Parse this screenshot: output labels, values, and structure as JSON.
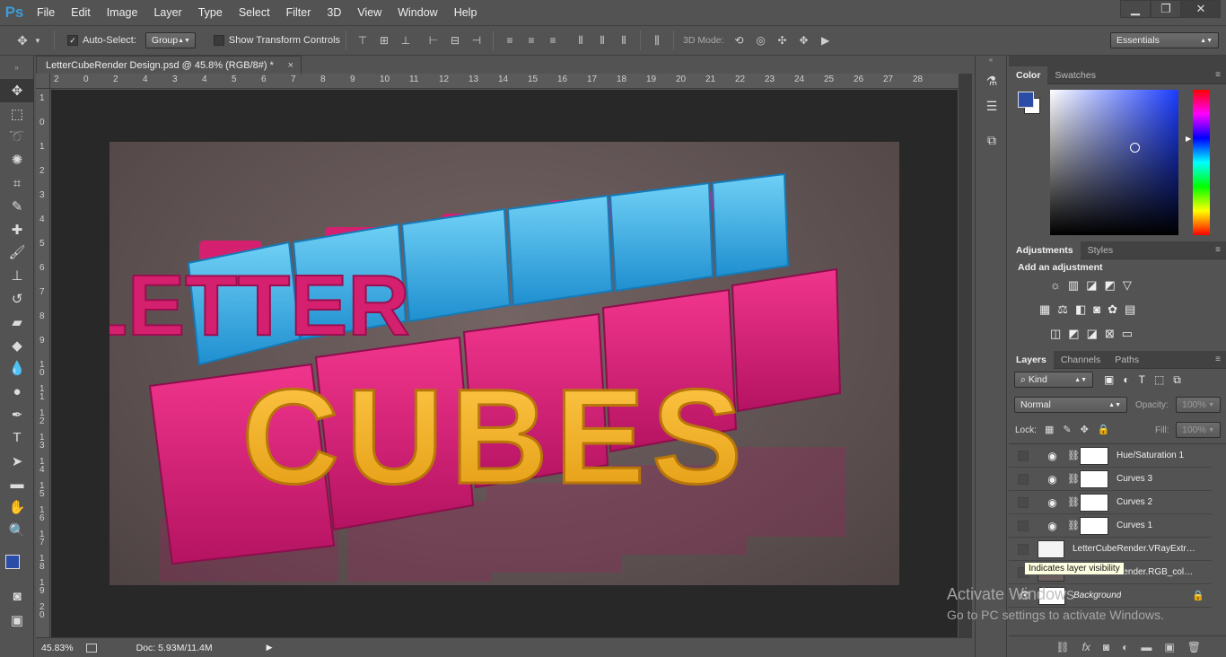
{
  "app": {
    "logo": "Ps"
  },
  "menu": [
    "File",
    "Edit",
    "Image",
    "Layer",
    "Type",
    "Select",
    "Filter",
    "3D",
    "View",
    "Window",
    "Help"
  ],
  "window_controls": {
    "minimize": "▁",
    "restore": "❐",
    "close": "✕"
  },
  "options": {
    "auto_select_label": "Auto-Select:",
    "auto_select_value": "Group",
    "transform_label": "Show Transform Controls",
    "mode_label": "3D Mode:",
    "workspace": "Essentials"
  },
  "document": {
    "tab_title": "LetterCubeRender Design.psd @ 45.8% (RGB/8#) *",
    "tab_close": "×",
    "zoom": "45.83%",
    "doc_size": "Doc: 5.93M/11.4M"
  },
  "rulers": {
    "h_ticks": [
      "2",
      "0",
      "2",
      "4",
      "3",
      "4",
      "5",
      "6",
      "7",
      "8",
      "9",
      "10",
      "11",
      "12",
      "13",
      "14",
      "15",
      "16",
      "17",
      "18",
      "19",
      "20",
      "21",
      "22",
      "23",
      "24",
      "25",
      "26",
      "27",
      "28"
    ],
    "v_ticks": [
      "1",
      "0",
      "1",
      "2",
      "3",
      "4",
      "5",
      "6",
      "7",
      "8",
      "9",
      "1 0",
      "1 1",
      "1 2",
      "1 3",
      "1 4",
      "1 5",
      "1 6",
      "1 7",
      "1 8",
      "1 9",
      "2 0"
    ]
  },
  "artwork": {
    "line1": "LETTER",
    "line2": "CUBES"
  },
  "color_panel": {
    "tabs": [
      "Color",
      "Swatches"
    ],
    "fg": "#2b4da8",
    "bg": "#ffffff",
    "hue": "#1a3cff"
  },
  "adjustments_panel": {
    "tabs": [
      "Adjustments",
      "Styles"
    ],
    "heading": "Add an adjustment"
  },
  "layers_panel": {
    "tabs": [
      "Layers",
      "Channels",
      "Paths"
    ],
    "kind_label": "Kind",
    "blend_mode": "Normal",
    "opacity_label": "Opacity:",
    "opacity_value": "100%",
    "lock_label": "Lock:",
    "fill_label": "Fill:",
    "fill_value": "100%",
    "layers": [
      {
        "name": "Hue/Saturation 1",
        "type": "adjustment"
      },
      {
        "name": "Curves 3",
        "type": "adjustment"
      },
      {
        "name": "Curves 2",
        "type": "adjustment"
      },
      {
        "name": "Curves 1",
        "type": "adjustment"
      },
      {
        "name": "LetterCubeRender.VRayExtr…",
        "type": "image"
      },
      {
        "name": "render.RGB_col…",
        "type": "image"
      },
      {
        "name": "Background",
        "type": "background"
      }
    ],
    "tooltip": "Indicates layer visibility"
  },
  "watermark": {
    "line1": "Activate Windows",
    "line2": "Go to PC settings to activate Windows."
  }
}
